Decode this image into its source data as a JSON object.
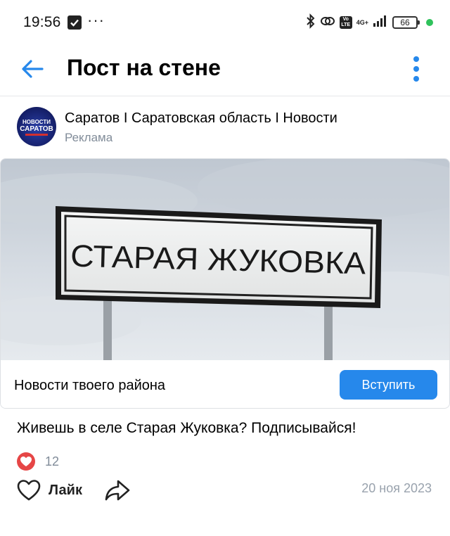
{
  "status_bar": {
    "time": "19:56",
    "dots": "···",
    "network": "4G+",
    "volte": "Vo LTE",
    "battery": "66"
  },
  "header": {
    "title": "Пост на стене"
  },
  "post": {
    "author_name": "Саратов I Саратовская область I Новости",
    "author_label": "Реклама",
    "avatar_text": [
      "НОВОСТИ",
      "САРАТОВ"
    ],
    "image": {
      "sign_text": "СТАРАЯ ЖУКОВКА"
    },
    "card_caption": "Новости твоего района",
    "join_label": "Вступить",
    "text": "Живешь в селе Старая Жуковка? Подписывайся!",
    "reactions_count": "12",
    "like_label": "Лайк",
    "date": "20 ноя 2023"
  },
  "colors": {
    "accent": "#2688eb",
    "heart": "#e64646",
    "secondary_text": "#818c99",
    "date_text": "#99a2ad",
    "status_green": "#2fc25b"
  },
  "icons": [
    "check-notification-icon",
    "bluetooth-icon",
    "link-icon",
    "signal-icon",
    "battery-icon",
    "back-arrow-icon",
    "more-vertical-icon",
    "heart-reaction-icon",
    "like-heart-icon",
    "share-icon"
  ]
}
